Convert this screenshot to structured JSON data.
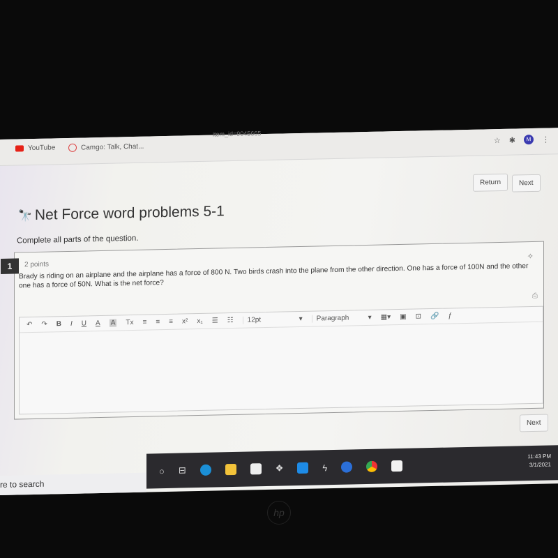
{
  "browser": {
    "url_fragment": "item_id=9045665",
    "bookmarks": [
      {
        "label": "YouTube",
        "icon": "youtube-icon"
      },
      {
        "label": "Camgo: Talk, Chat..."
      }
    ],
    "avatar": "M"
  },
  "nav": {
    "return_label": "Return",
    "next_label": "Next"
  },
  "page": {
    "title": "Net Force word problems 5-1",
    "instructions": "Complete all parts of the question."
  },
  "question": {
    "number": "1",
    "points": "2 points",
    "text": "Brady is riding on an airplane and the airplane has a force of 800 N. Two birds crash into the plane from the other direction. One has a force of 100N and the other one has a force of 50N. What is the net force?"
  },
  "editor": {
    "bold": "B",
    "italic": "I",
    "underline": "U",
    "font_color": "A",
    "bg_color": "A",
    "clear_format": "Tx",
    "superscript": "x²",
    "subscript": "x₁",
    "font_size": "12pt",
    "block_format": "Paragraph",
    "answer": ""
  },
  "footer": {
    "next_label": "Next"
  },
  "taskbar": {
    "search_text": "re to search",
    "time": "11:43 PM",
    "date": "3/1/2021"
  },
  "device": {
    "logo": "hp"
  }
}
